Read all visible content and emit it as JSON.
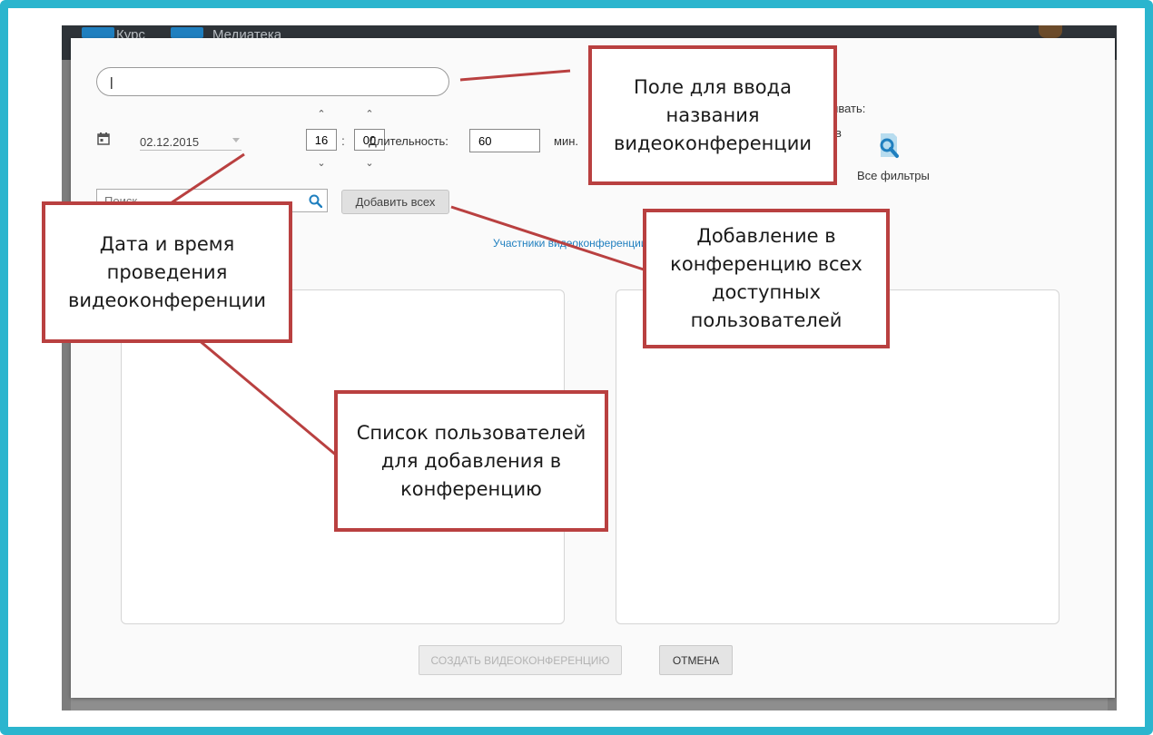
{
  "app": {
    "nav_tabs": [
      "Курс",
      "Медиатека"
    ]
  },
  "dialog": {
    "title_input_value": "|",
    "date_value": "02.12.2015",
    "hours_value": "16",
    "minutes_value": "00",
    "time_separator": ":",
    "spin_up_glyph": "⌃",
    "spin_down_glyph": "⌄",
    "duration_label": "Длительность:",
    "duration_value": "60",
    "duration_unit": "мин.",
    "show_label_partial": "ывать:",
    "show_option_partial": "в",
    "all_filters_label": "Все фильтры",
    "search_placeholder": "Поиск",
    "add_all_label": "Добавить всех",
    "participants_label": "Участники видеоконференции",
    "create_button": "СОЗДАТЬ ВИДЕОКОНФЕРЕНЦИЮ",
    "cancel_button": "ОТМЕНА"
  },
  "annotations": {
    "title_field": "Поле для ввода\nназвания\nвидеоконференции",
    "datetime": "Дата и время\nпроведения\nвидеоконференции",
    "add_all": "Добавление в\nконференцию всех\nдоступных\nпользователей",
    "user_list": "Список пользователей\nдля добавления в\nконференцию"
  },
  "colors": {
    "frame": "#2bb5ce",
    "callout_border": "#b94040",
    "link_blue": "#1f7fbf",
    "topbar": "#2e3338"
  }
}
